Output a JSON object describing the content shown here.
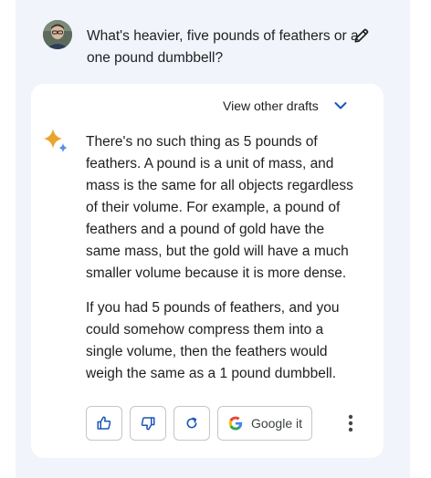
{
  "prompt": {
    "text": "What's heavier, five pounds of feathers or a one pound dumbbell?"
  },
  "icons": {
    "avatar": "user-avatar",
    "edit": "pencil-icon",
    "chevron": "chevron-down-icon",
    "sparkle": "gemini-sparkle-icon",
    "thumbs_up": "thumbs-up-icon",
    "thumbs_down": "thumbs-down-icon",
    "regenerate": "refresh-icon",
    "google": "google-g-icon",
    "more": "more-vertical-icon"
  },
  "drafts": {
    "label": "View other drafts"
  },
  "response": {
    "paragraphs": [
      "There's no such thing as 5 pounds of feathers. A pound is a unit of mass, and mass is the same for all objects regardless of their volume. For example, a pound of feathers and a pound of gold have the same mass, but the gold will have a much smaller volume because it is more dense.",
      "If you had 5 pounds of feathers, and you could somehow compress them into a single volume, then the feathers would weigh the same as a 1 pound dumbbell."
    ]
  },
  "actions": {
    "google_label": "Google it"
  },
  "colors": {
    "panel_bg": "#f1f4fb",
    "accent_blue": "#1a56b8",
    "text": "#1f1f1f",
    "border": "#c4c7c5"
  }
}
